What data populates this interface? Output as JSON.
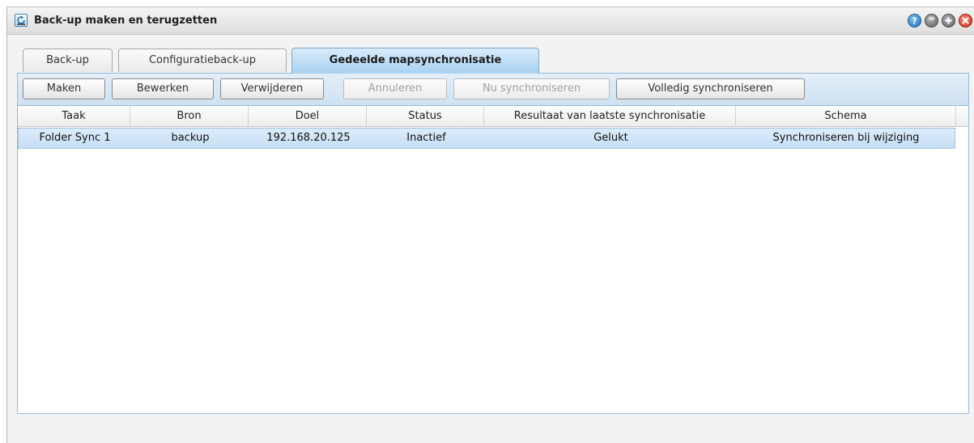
{
  "window": {
    "title": "Back-up maken en terugzetten",
    "app_icon": "backup-app-icon",
    "controls": [
      "help-icon",
      "minimize-icon",
      "maximize-icon",
      "close-icon"
    ]
  },
  "tabs": [
    {
      "label": "Back-up",
      "active": false
    },
    {
      "label": "Configuratieback-up",
      "active": false
    },
    {
      "label": "Gedeelde mapsynchronisatie",
      "active": true
    }
  ],
  "toolbar": {
    "buttons": [
      {
        "label": "Maken",
        "enabled": true
      },
      {
        "label": "Bewerken",
        "enabled": true
      },
      {
        "label": "Verwijderen",
        "enabled": true
      },
      {
        "label": "Annuleren",
        "enabled": false
      },
      {
        "label": "Nu synchroniseren",
        "enabled": false
      },
      {
        "label": "Volledig synchroniseren",
        "enabled": true
      }
    ]
  },
  "table": {
    "columns": [
      "Taak",
      "Bron",
      "Doel",
      "Status",
      "Resultaat van laatste synchronisatie",
      "Schema"
    ],
    "rows": [
      {
        "cells": [
          "Folder Sync 1",
          "backup",
          "192.168.20.125",
          "Inactief",
          "Gelukt",
          "Synchroniseren bij wijziging"
        ],
        "selected": true
      }
    ]
  },
  "colors": {
    "accent": "#a8d1f1",
    "selected_row": "#c7def5",
    "close": "#d12a16",
    "help": "#1e6fb6"
  }
}
